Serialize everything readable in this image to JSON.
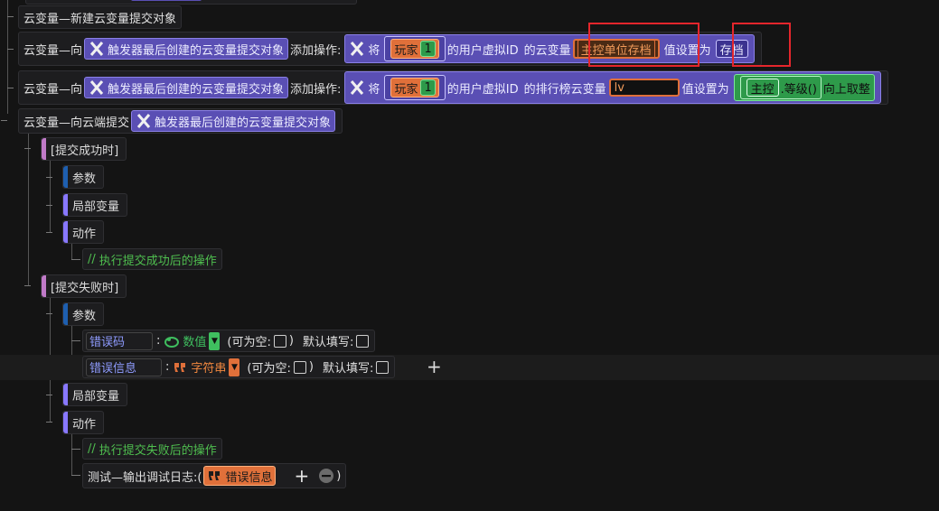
{
  "rows": {
    "new_obj": {
      "text": "云变量—新建云变量提交对象"
    },
    "op1": {
      "prefix": "云变量—向",
      "obj": "触发器最后创建的云变量提交对象",
      "add": "添加操作:",
      "set": "将",
      "player": "玩家",
      "player_num": "1",
      "vid": "的用户虚拟ID",
      "cloud_var": "的云变量",
      "var_name": "主控单位存档",
      "value_set": "值设置为",
      "value": "存档"
    },
    "op2": {
      "prefix": "云变量—向",
      "obj": "触发器最后创建的云变量提交对象",
      "add": "添加操作:",
      "set": "将",
      "player": "玩家",
      "player_num": "1",
      "vid": "的用户虚拟ID",
      "rank_var": "的排行榜云变量",
      "var_name": "lv",
      "value_set": "值设置为",
      "unit": "主控",
      "level": ".等级()",
      "ceil": "向上取整"
    },
    "submit": {
      "prefix": "云变量—向云端提交",
      "obj": "触发器最后创建的云变量提交对象"
    }
  },
  "success": {
    "title": "[提交成功时]",
    "params": "参数",
    "locals": "局部变量",
    "actions": "动作",
    "comment": "执行提交成功后的操作"
  },
  "failure": {
    "title": "[提交失败时]",
    "params": "参数",
    "param1": {
      "name": "错误码",
      "type": "数值",
      "nullable": "(可为空:",
      "close": ")",
      "default": "默认填写:"
    },
    "param2": {
      "name": "错误信息",
      "type": "字符串",
      "nullable": "(可为空:",
      "close": ")",
      "default": "默认填写:"
    },
    "locals": "局部变量",
    "actions": "动作",
    "comment": "执行提交失败后的操作",
    "log": "测试—输出调试日志:(",
    "log_arg": "错误信息",
    "log_close": ")"
  },
  "comment_prefix": "//",
  "add_symbol": "+",
  "colors": {
    "background": "#141414",
    "purple": "#5a4fb4",
    "orange": "#e0703a",
    "green": "#2e9a4a",
    "highlight": "#e5262c",
    "param_bar": "#1e5fb0",
    "locals_bar": "#8878ff",
    "event_bar": "#c07ac8"
  },
  "icons": [
    "function-x-icon",
    "number-type-icon",
    "string-type-icon",
    "dropdown-icon",
    "remove-icon",
    "add-icon"
  ]
}
